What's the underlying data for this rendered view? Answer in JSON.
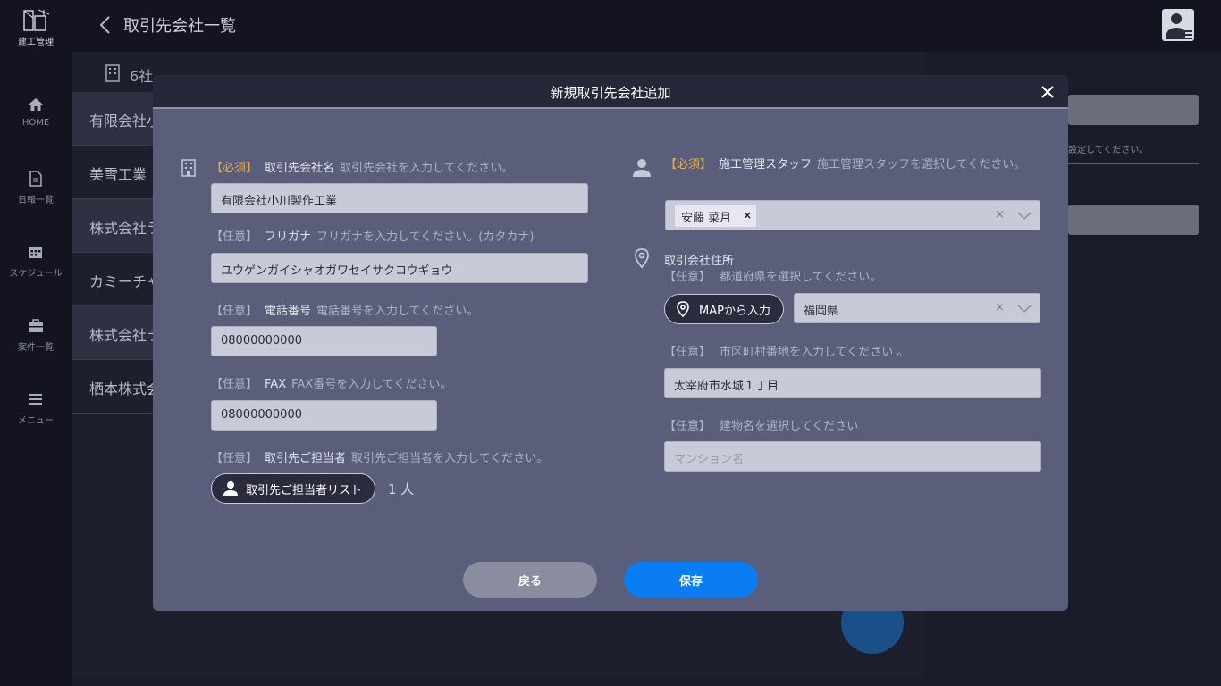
{
  "app": {
    "logo_text": "建工管理",
    "page_title": "取引先会社一覧"
  },
  "sidebar": {
    "items": [
      {
        "label": "HOME",
        "icon": "home-icon"
      },
      {
        "label": "日報一覧",
        "icon": "document-icon"
      },
      {
        "label": "スケジュール",
        "icon": "calendar-icon"
      },
      {
        "label": "案件一覧",
        "icon": "briefcase-icon"
      },
      {
        "label": "メニュー",
        "icon": "menu-icon"
      }
    ]
  },
  "background": {
    "count": "6社",
    "rows": [
      "有限会社小",
      "美雪工業",
      "株式会社ラ",
      "カミーチャ",
      "株式会社ラ",
      "栖本株式会"
    ],
    "right_hint": "設定してください。"
  },
  "modal": {
    "title": "新規取引先会社追加",
    "left": {
      "company_name": {
        "tag": "【必須】",
        "name": "取引先会社名",
        "hint": "取引先会社を入力してください。",
        "value": "有限会社小川製作工業"
      },
      "furigana": {
        "tag": "【任意】",
        "name": "フリガナ",
        "hint": "フリガナを入力してください。(カタカナ)",
        "value": "ユウゲンガイシャオガワセイサクコウギョウ"
      },
      "phone": {
        "tag": "【任意】",
        "name": "電話番号",
        "hint": "電話番号を入力してください。",
        "value": "08000000000"
      },
      "fax": {
        "tag": "【任意】",
        "name": "FAX",
        "hint": "FAX番号を入力してください。",
        "value": "08000000000"
      },
      "contact": {
        "tag": "【任意】",
        "name": "取引先ご担当者",
        "hint": "取引先ご担当者を入力してください。",
        "button_label": "取引先ご担当者リスト",
        "count": "1 人"
      }
    },
    "right": {
      "staff": {
        "tag": "【必須】",
        "name": "施工管理スタッフ",
        "hint": "施工管理スタッフを選択してください。",
        "selected": "安藤 菜月",
        "chip_remove": "×",
        "clear": "×"
      },
      "address": {
        "heading": "取引会社住所",
        "prefecture": {
          "tag": "【任意】",
          "hint": "都道府県を選択してください。",
          "map_button": "MAPから入力",
          "value": "福岡県",
          "clear": "×"
        },
        "city": {
          "tag": "【任意】",
          "hint": "市区町村番地を入力してください 。",
          "value": "太宰府市水城１丁目"
        },
        "building": {
          "tag": "【任意】",
          "hint": "建物名を選択してください",
          "placeholder": "マンション名"
        }
      }
    },
    "buttons": {
      "back": "戻る",
      "save": "保存"
    }
  },
  "colors": {
    "required": "#f2a93b",
    "primary": "#0a7df3",
    "modal_bg": "#5b5e7a",
    "header_bg": "#252839"
  }
}
